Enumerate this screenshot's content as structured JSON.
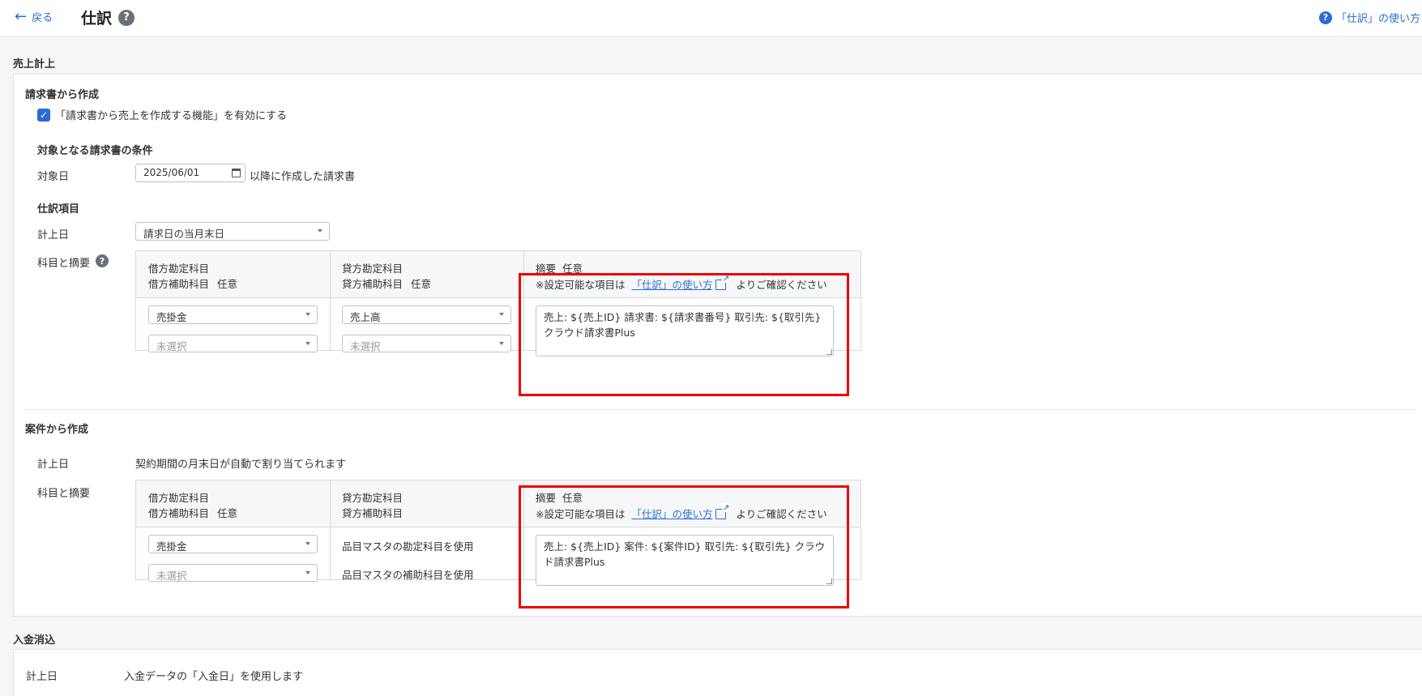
{
  "header": {
    "back_label": "戻る",
    "page_title": "仕訳",
    "help_link": "「仕訳」の使い方"
  },
  "sales": {
    "section_title": "売上計上",
    "from_invoice": {
      "title": "請求書から作成",
      "enable_label": "「請求書から売上を作成する機能」を有効にする",
      "enabled": true,
      "conditions_title": "対象となる請求書の条件",
      "target_date_label": "対象日",
      "target_date_value": "2025/06/01",
      "target_date_suffix": "以降に作成した請求書",
      "journal_items_title": "仕訳項目",
      "posting_date_label": "計上日",
      "posting_date_value": "請求日の当月末日",
      "accounts_label": "科目と摘要",
      "table": {
        "debit_header_1": "借方勘定科目",
        "debit_header_2": "借方補助科目",
        "optional": "任意",
        "credit_header_1": "貸方勘定科目",
        "credit_header_2": "貸方補助科目",
        "memo_header": "摘要",
        "memo_note_prefix": "※設定可能な項目は",
        "memo_note_link": "「仕訳」の使い方",
        "memo_note_suffix": "よりご確認ください",
        "debit_account": "売掛金",
        "debit_sub": "未選択",
        "credit_account": "売上高",
        "credit_sub": "未選択",
        "memo_value": "売上: ${売上ID} 請求書: ${請求書番号} 取引先: ${取引先} クラウド請求書Plus"
      }
    },
    "from_project": {
      "title": "案件から作成",
      "posting_date_label": "計上日",
      "posting_date_text": "契約期間の月末日が自動で割り当てられます",
      "accounts_label": "科目と摘要",
      "table": {
        "debit_header_1": "借方勘定科目",
        "debit_header_2": "借方補助科目",
        "optional": "任意",
        "credit_header_1": "貸方勘定科目",
        "credit_header_2": "貸方補助科目",
        "memo_header": "摘要",
        "memo_note_prefix": "※設定可能な項目は",
        "memo_note_link": "「仕訳」の使い方",
        "memo_note_suffix": "よりご確認ください",
        "debit_account": "売掛金",
        "debit_sub": "未選択",
        "credit_account_text": "品目マスタの勘定科目を使用",
        "credit_sub_text": "品目マスタの補助科目を使用",
        "memo_value": "売上: ${売上ID} 案件: ${案件ID} 取引先: ${取引先} クラウド請求書Plus"
      }
    }
  },
  "payment": {
    "section_title": "入金消込",
    "posting_date_label": "計上日",
    "posting_date_text": "入金データの「入金日」を使用します"
  },
  "colors": {
    "accent": "#2b6cd6",
    "highlight": "#ee0000"
  }
}
